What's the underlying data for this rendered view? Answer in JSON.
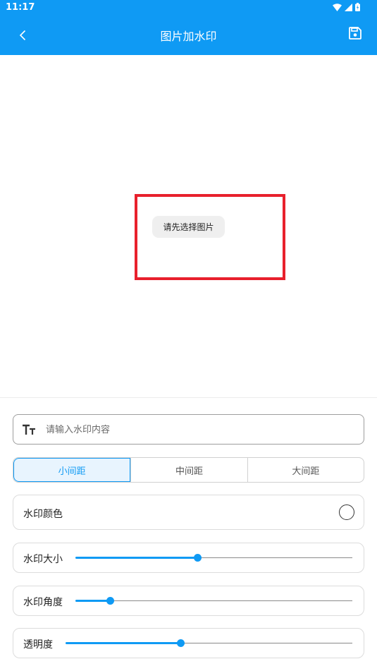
{
  "status_bar": {
    "time": "11:17"
  },
  "app_bar": {
    "title": "图片加水印"
  },
  "preview": {
    "hint": "请先选择图片"
  },
  "watermark_input": {
    "placeholder": "请输入水印内容",
    "value": ""
  },
  "spacing": {
    "options": [
      "小间距",
      "中间距",
      "大间距"
    ],
    "selected": "小间距"
  },
  "color_row": {
    "label": "水印颜色"
  },
  "size_row": {
    "label": "水印大小",
    "value_fraction": 0.44
  },
  "angle_row": {
    "label": "水印角度",
    "value_fraction": 0.125
  },
  "opacity_row": {
    "label": "透明度",
    "value_fraction": 0.4
  },
  "colors": {
    "accent": "#0f9af4",
    "frame": "#e8202c"
  }
}
